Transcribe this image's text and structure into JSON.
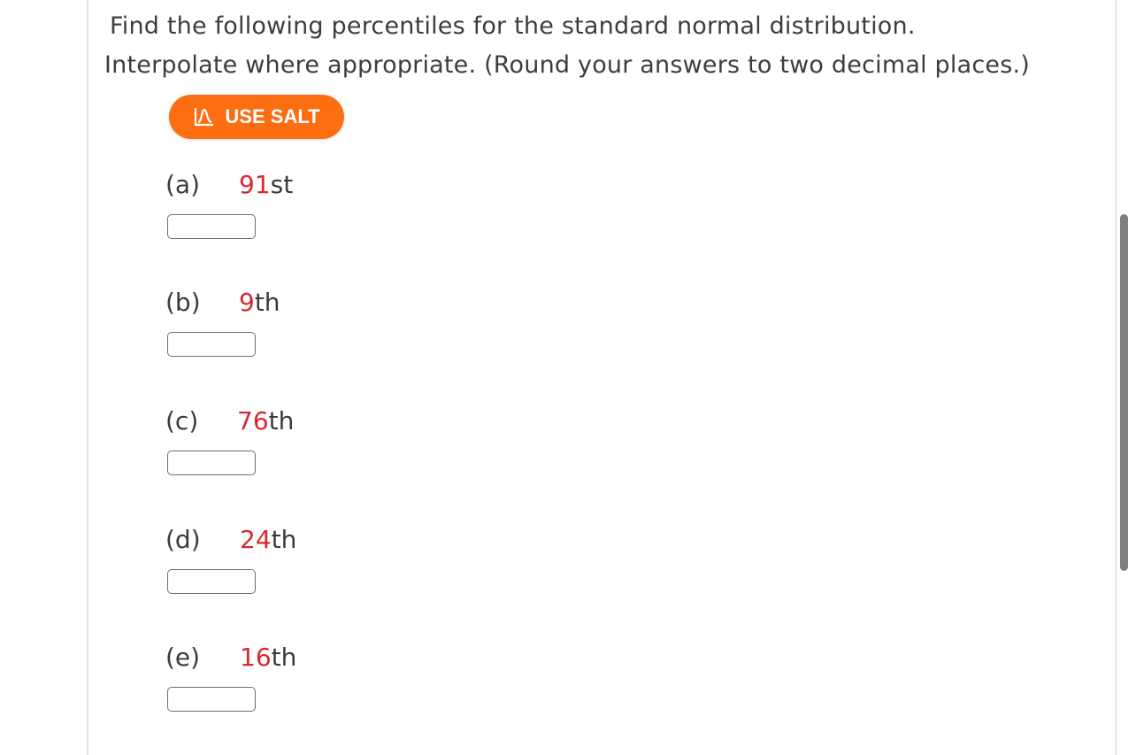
{
  "question": {
    "line1": "Find the following percentiles for the standard normal distribution.",
    "line2": "Interpolate where appropriate. (Round your answers to two decimal places.)"
  },
  "salt_button": {
    "label": "USE SALT",
    "icon": "bell-curve-icon",
    "color": "#fd6e12"
  },
  "accent_color": "#d7282f",
  "parts": [
    {
      "label": "(a)",
      "number": "91",
      "suffix": "st",
      "answer": ""
    },
    {
      "label": "(b)",
      "number": "9",
      "suffix": "th",
      "answer": ""
    },
    {
      "label": "(c)",
      "number": "76",
      "suffix": "th",
      "answer": ""
    },
    {
      "label": "(d)",
      "number": "24",
      "suffix": "th",
      "answer": ""
    },
    {
      "label": "(e)",
      "number": "16",
      "suffix": "th",
      "answer": ""
    }
  ]
}
